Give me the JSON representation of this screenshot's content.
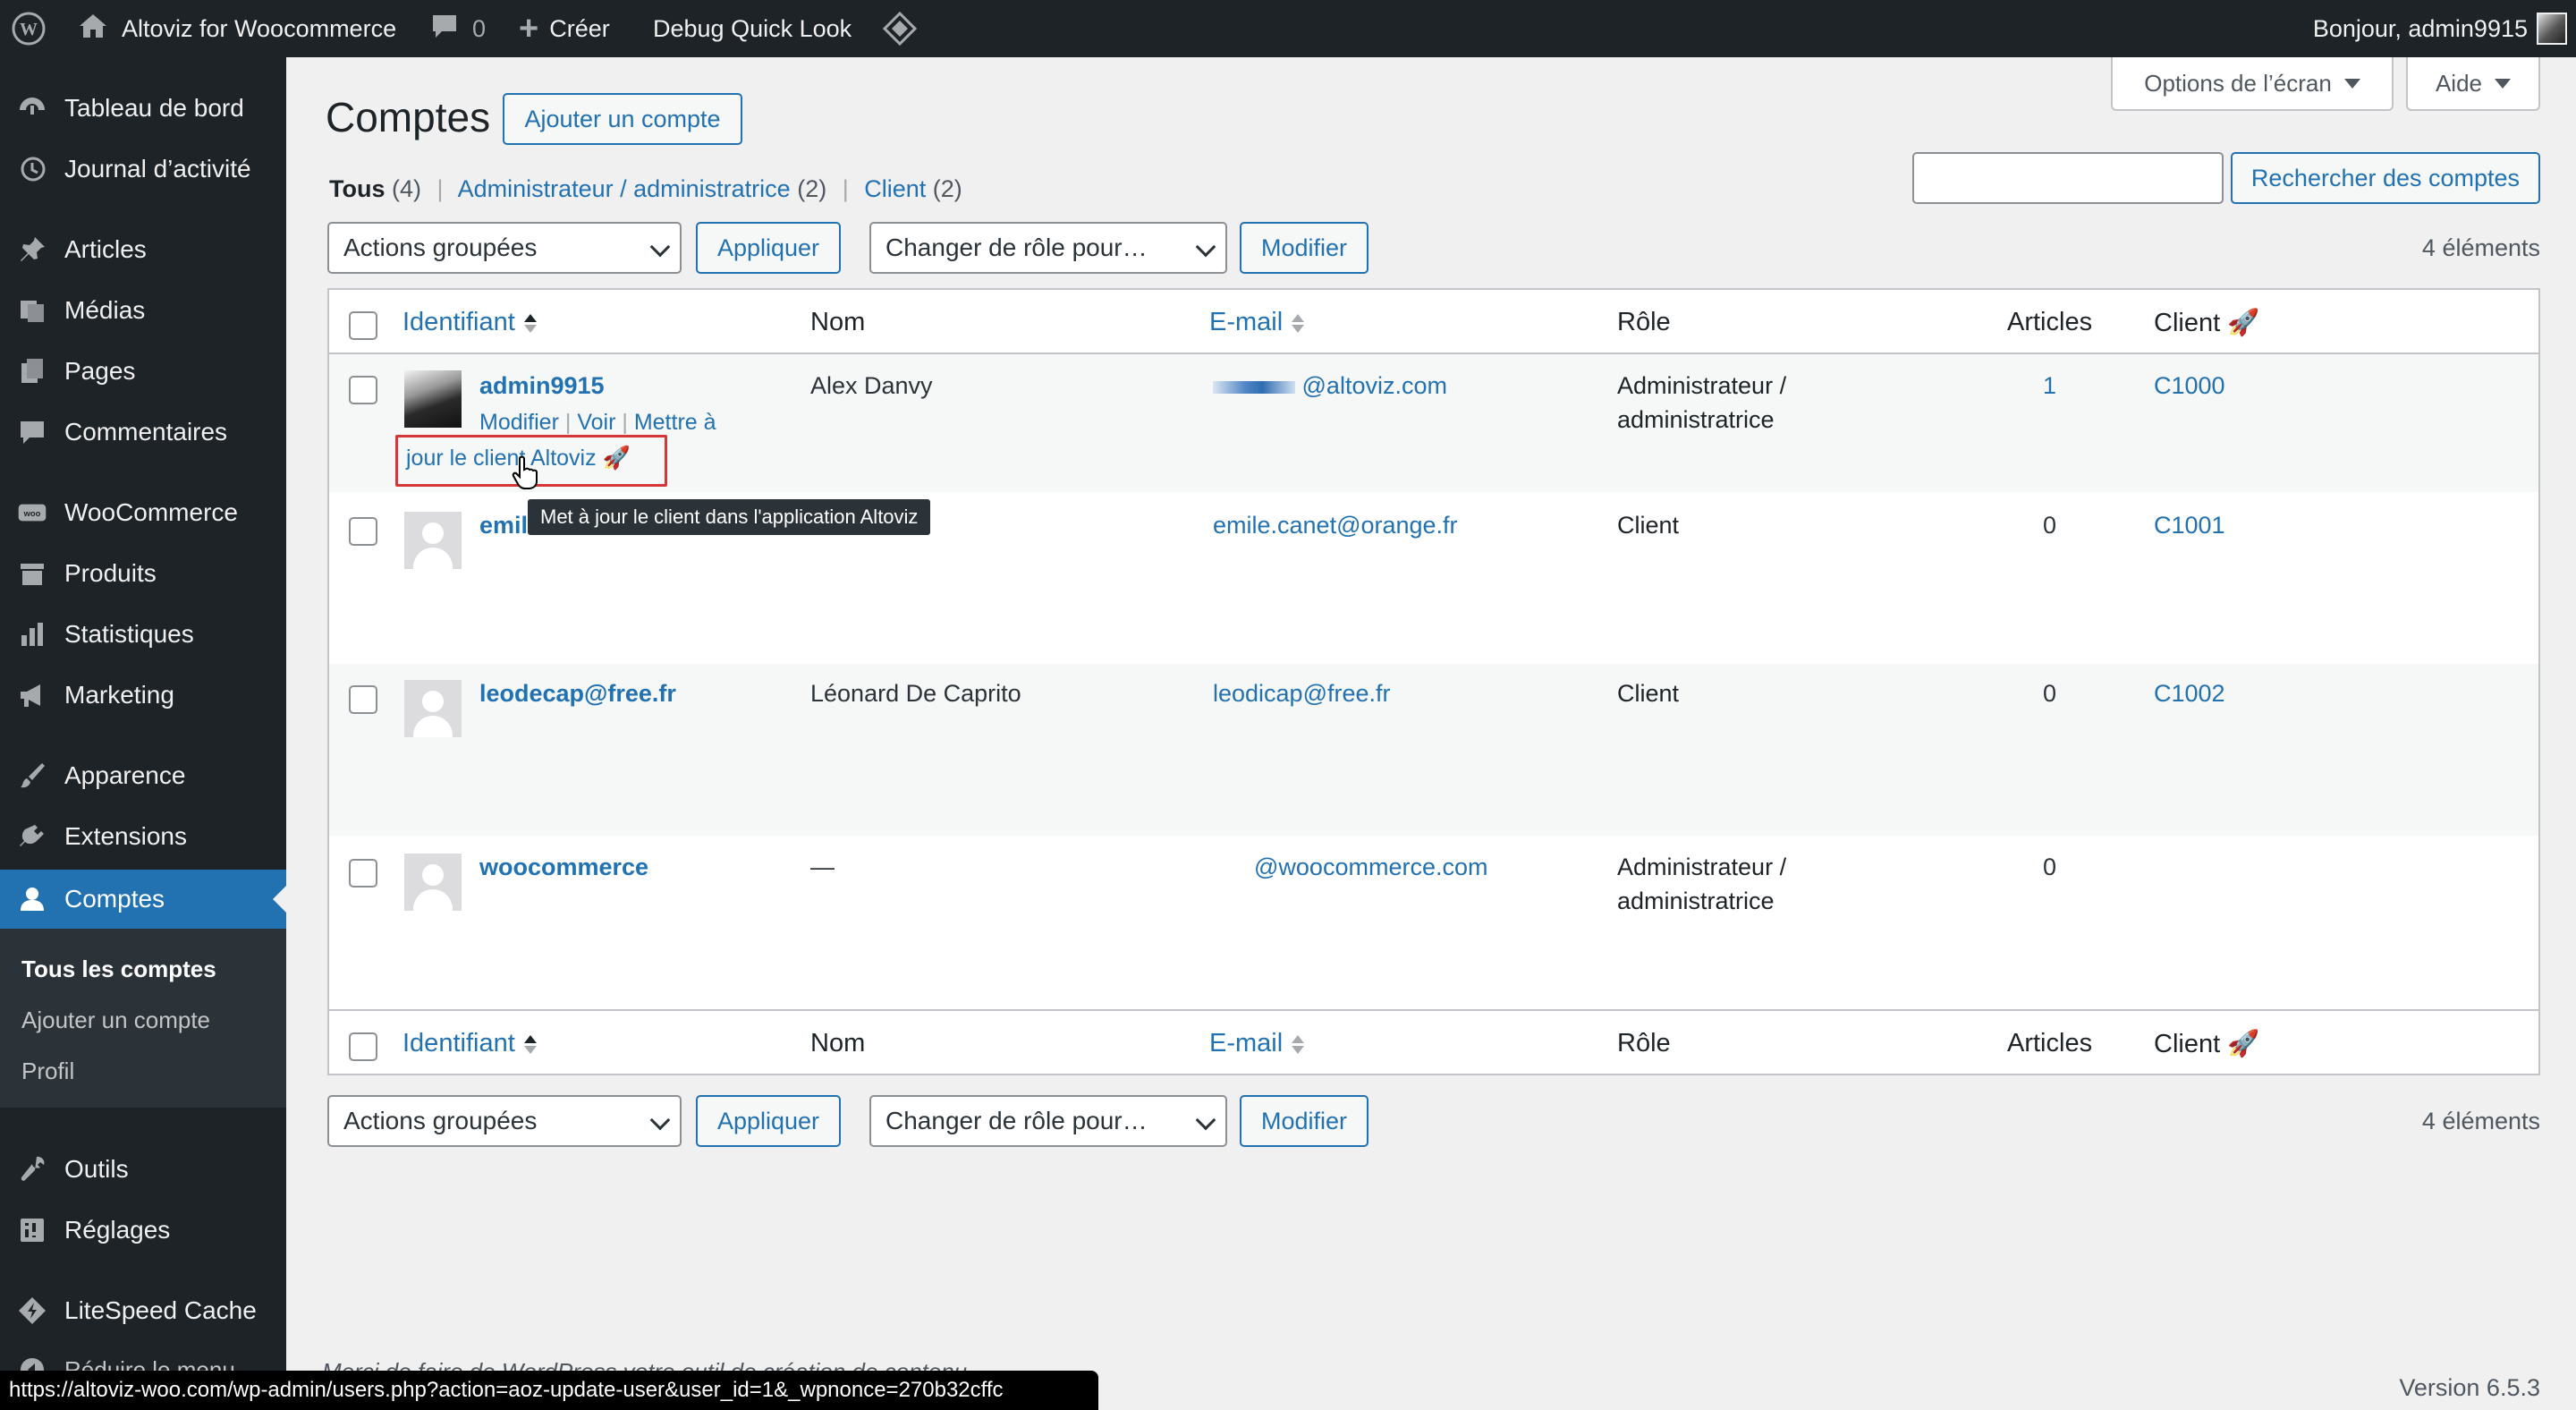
{
  "admin_bar": {
    "site_name": "Altoviz for Woocommerce",
    "comments_count": "0",
    "new_label": "Créer",
    "debug_label": "Debug Quick Look",
    "greeting": "Bonjour, admin9915"
  },
  "sidebar": {
    "items": [
      {
        "label": "Tableau de bord",
        "icon": "dashboard-icon"
      },
      {
        "label": "Journal d’activité",
        "icon": "activity-log-icon"
      },
      {
        "label": "Articles",
        "icon": "pin-icon"
      },
      {
        "label": "Médias",
        "icon": "media-icon"
      },
      {
        "label": "Pages",
        "icon": "pages-icon"
      },
      {
        "label": "Commentaires",
        "icon": "comments-icon"
      },
      {
        "label": "WooCommerce",
        "icon": "woocommerce-icon"
      },
      {
        "label": "Produits",
        "icon": "products-icon"
      },
      {
        "label": "Statistiques",
        "icon": "stats-icon"
      },
      {
        "label": "Marketing",
        "icon": "megaphone-icon"
      },
      {
        "label": "Apparence",
        "icon": "brush-icon"
      },
      {
        "label": "Extensions",
        "icon": "plugin-icon"
      },
      {
        "label": "Comptes",
        "icon": "users-icon"
      },
      {
        "label": "Outils",
        "icon": "wrench-icon"
      },
      {
        "label": "Réglages",
        "icon": "settings-icon"
      },
      {
        "label": "LiteSpeed Cache",
        "icon": "litespeed-icon"
      },
      {
        "label": "Réduire le menu",
        "icon": "collapse-icon"
      }
    ],
    "submenu": [
      "Tous les comptes",
      "Ajouter un compte",
      "Profil"
    ]
  },
  "screen_options": "Options de l’écran",
  "help": "Aide",
  "page": {
    "title": "Comptes",
    "add_button": "Ajouter un compte"
  },
  "filters": {
    "all": "Tous",
    "all_count": "(4)",
    "admin": "Administrateur / administratrice",
    "admin_count": "(2)",
    "client": "Client",
    "client_count": "(2)",
    "separator": "|"
  },
  "search": {
    "value": "",
    "button": "Rechercher des comptes"
  },
  "bulk": {
    "actions": "Actions groupées",
    "apply": "Appliquer",
    "role": "Changer de rôle pour…",
    "modify": "Modifier",
    "count": "4 éléments"
  },
  "table": {
    "headers": {
      "username": "Identifiant",
      "name": "Nom",
      "email": "E-mail",
      "role": "Rôle",
      "posts": "Articles",
      "client": "Client 🚀"
    },
    "rows": [
      {
        "username": "admin9915",
        "name": "Alex Danvy",
        "email": "@altoviz.com",
        "role_line1": "Administrateur /",
        "role_line2": "administratrice",
        "posts": "1",
        "client": "C1000"
      },
      {
        "username": "emil",
        "name": "",
        "email": "emile.canet@orange.fr",
        "role_line1": "Client",
        "role_line2": "",
        "posts": "0",
        "client": "C1001"
      },
      {
        "username": "leodecap@free.fr",
        "name": "Léonard De Caprito",
        "email": "leodicap@free.fr",
        "role_line1": "Client",
        "role_line2": "",
        "posts": "0",
        "client": "C1002"
      },
      {
        "username": "woocommerce",
        "name": "—",
        "email": "@woocommerce.com",
        "role_line1": "Administrateur /",
        "role_line2": "administratrice",
        "posts": "0",
        "client": ""
      }
    ],
    "row_actions": {
      "edit": "Modifier",
      "view": "Voir",
      "update_line1": "Mettre à",
      "update_line2": "jour le client Altoviz 🚀",
      "sep": "|"
    }
  },
  "tooltip": "Met à jour le client dans l'application Altoviz",
  "footer": {
    "thanks": "Merci de faire de WordPress votre outil de création de contenu.",
    "version": "Version 6.5.3"
  },
  "status_url": "https://altoviz-woo.com/wp-admin/users.php?action=aoz-update-user&user_id=1&_wpnonce=270b32cffc",
  "colors": {
    "accent": "#2271b1",
    "highlight_box": "#d63638",
    "sidebar": "#1d2327"
  }
}
